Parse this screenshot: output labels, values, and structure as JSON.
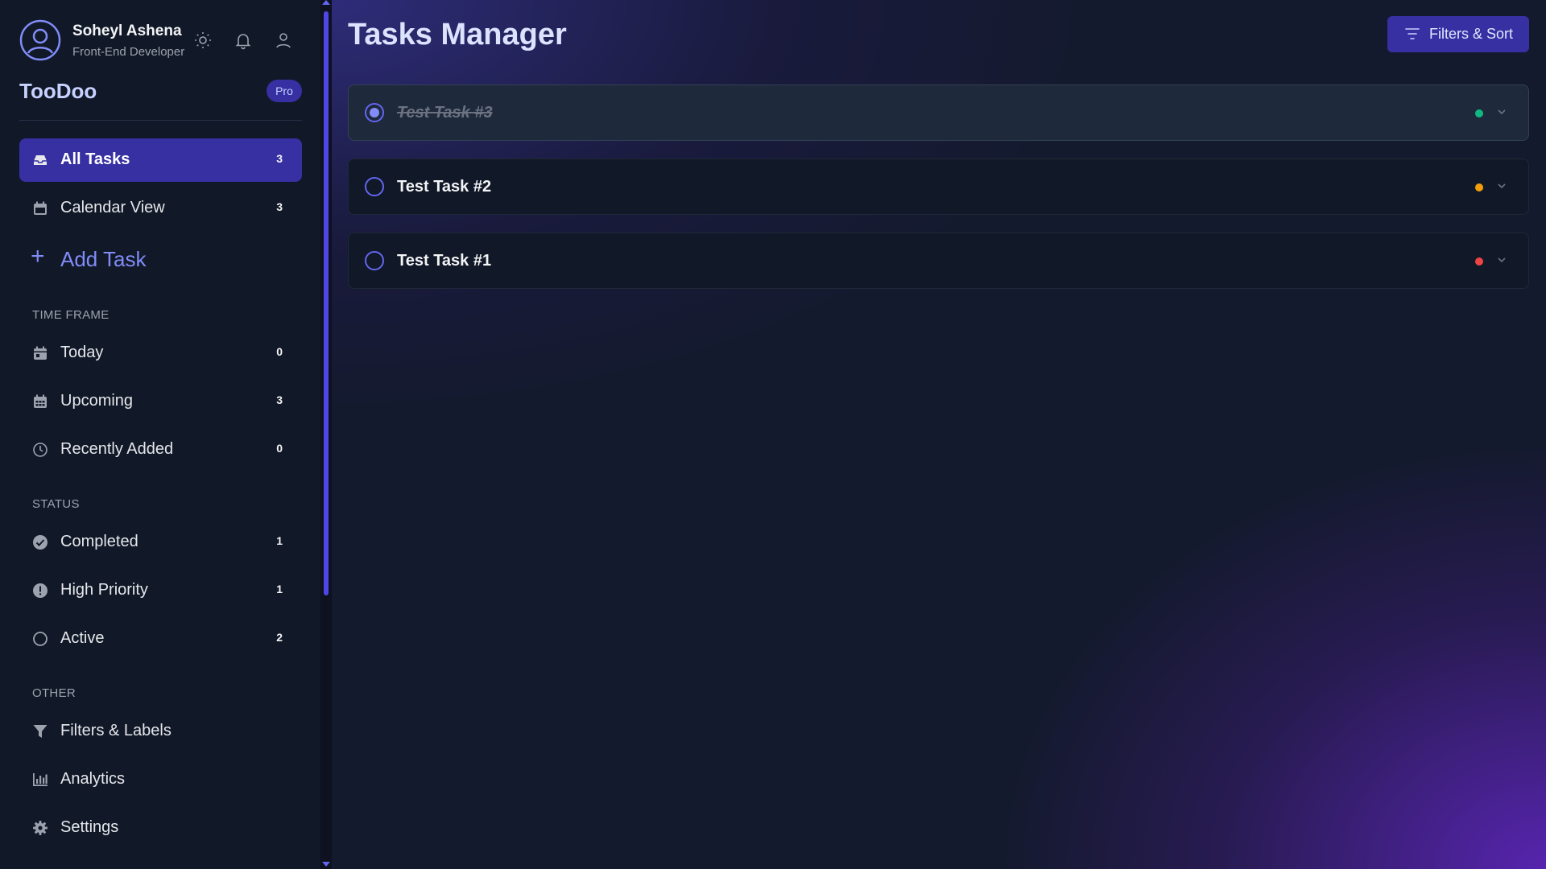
{
  "profile": {
    "name": "Soheyl Ashena",
    "role": "Front-End Developer"
  },
  "brand": {
    "name": "TooDoo",
    "badge": "Pro"
  },
  "nav": {
    "all_tasks": {
      "label": "All Tasks",
      "count": "3"
    },
    "calendar_view": {
      "label": "Calendar View",
      "count": "3"
    },
    "add_task": {
      "label": "Add Task"
    }
  },
  "sections": {
    "time_frame": {
      "heading": "TIME FRAME",
      "today": {
        "label": "Today",
        "count": "0"
      },
      "upcoming": {
        "label": "Upcoming",
        "count": "3"
      },
      "recently_added": {
        "label": "Recently Added",
        "count": "0"
      }
    },
    "status": {
      "heading": "STATUS",
      "completed": {
        "label": "Completed",
        "count": "1"
      },
      "high_priority": {
        "label": "High Priority",
        "count": "1"
      },
      "active": {
        "label": "Active",
        "count": "2"
      }
    },
    "other": {
      "heading": "OTHER",
      "filters_labels": {
        "label": "Filters & Labels"
      },
      "analytics": {
        "label": "Analytics"
      },
      "settings": {
        "label": "Settings"
      }
    }
  },
  "main": {
    "title": "Tasks Manager",
    "filters_button": "Filters & Sort",
    "tasks": [
      {
        "name": "Test Task #3",
        "completed": true,
        "priority_color": "#10b981"
      },
      {
        "name": "Test Task #2",
        "completed": false,
        "priority_color": "#f59e0b"
      },
      {
        "name": "Test Task #1",
        "completed": false,
        "priority_color": "#ef4444"
      }
    ]
  },
  "colors": {
    "accent": "#3730a3",
    "accent_light": "#818cf8",
    "sidebar_bg": "#111827"
  },
  "icons": [
    "user-circle-icon",
    "sun-icon",
    "bell-icon",
    "user-icon",
    "inbox-icon",
    "calendar-icon",
    "plus-icon",
    "calendar-day-icon",
    "calendar-grid-icon",
    "clock-icon",
    "check-circle-icon",
    "exclamation-circle-icon",
    "circle-icon",
    "filter-funnel-icon",
    "bar-chart-icon",
    "gear-icon",
    "filter-lines-icon",
    "chevron-down-icon"
  ]
}
